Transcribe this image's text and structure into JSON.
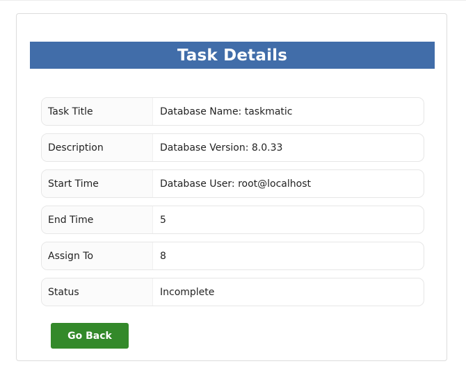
{
  "header": {
    "title": "Task Details"
  },
  "details": [
    {
      "label": "Task Title",
      "value": "Database Name: taskmatic"
    },
    {
      "label": "Description",
      "value": "Database Version: 8.0.33"
    },
    {
      "label": "Start Time",
      "value": "Database User: root@localhost"
    },
    {
      "label": "End Time",
      "value": "5"
    },
    {
      "label": "Assign To",
      "value": "8"
    },
    {
      "label": "Status",
      "value": "Incomplete"
    }
  ],
  "actions": {
    "back_label": "Go Back"
  },
  "colors": {
    "header_bg": "#416da9",
    "back_button_bg": "#33892a"
  }
}
